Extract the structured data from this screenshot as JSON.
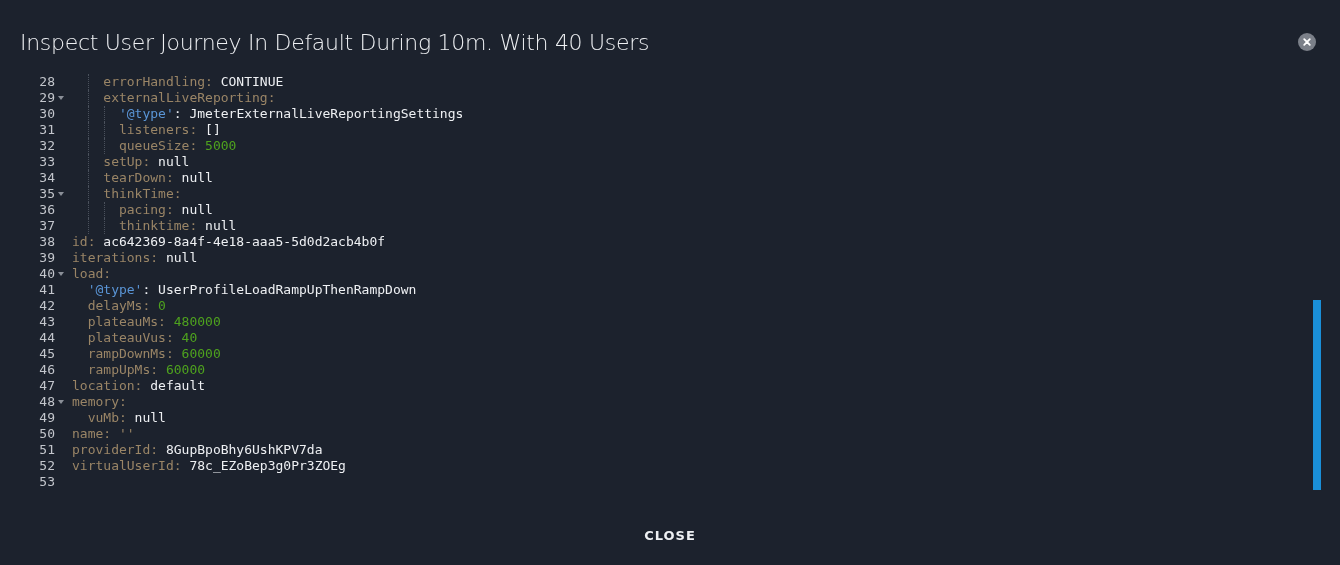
{
  "dialog": {
    "title": "Inspect User Journey In Default During 10m. With 40 Users"
  },
  "editor": {
    "lines": [
      {
        "children": [
          {
            "children": [
              {
                "number": "28",
                "foldable": false,
                "tokens": [
                  {
                    "kind": "key",
                    "text": "errorHandling:"
                  },
                  {
                    "kind": "plain",
                    "text": " CONTINUE"
                  }
                ]
              },
              {
                "number": "29",
                "foldable": true,
                "tokens": [
                  {
                    "kind": "key",
                    "text": "externalLiveReporting:"
                  }
                ],
                "children": [
                  {
                    "number": "30",
                    "foldable": false,
                    "tokens": [
                      {
                        "kind": "type",
                        "text": "'@type'"
                      },
                      {
                        "kind": "plain",
                        "text": ": JmeterExternalLiveReportingSettings"
                      }
                    ]
                  },
                  {
                    "number": "31",
                    "foldable": false,
                    "tokens": [
                      {
                        "kind": "key",
                        "text": "listeners:"
                      },
                      {
                        "kind": "plain",
                        "text": " []"
                      }
                    ]
                  },
                  {
                    "number": "32",
                    "foldable": false,
                    "tokens": [
                      {
                        "kind": "key",
                        "text": "queueSize:"
                      },
                      {
                        "kind": "number",
                        "text": " 5000"
                      }
                    ]
                  }
                ]
              },
              {
                "number": "33",
                "foldable": false,
                "tokens": [
                  {
                    "kind": "key",
                    "text": "setUp:"
                  },
                  {
                    "kind": "plain",
                    "text": " null"
                  }
                ]
              },
              {
                "number": "34",
                "foldable": false,
                "tokens": [
                  {
                    "kind": "key",
                    "text": "tearDown:"
                  },
                  {
                    "kind": "plain",
                    "text": " null"
                  }
                ]
              },
              {
                "number": "35",
                "foldable": true,
                "tokens": [
                  {
                    "kind": "key",
                    "text": "thinkTime:"
                  }
                ],
                "children": [
                  {
                    "number": "36",
                    "foldable": false,
                    "tokens": [
                      {
                        "kind": "key",
                        "text": "pacing:"
                      },
                      {
                        "kind": "plain",
                        "text": " null"
                      }
                    ]
                  },
                  {
                    "number": "37",
                    "foldable": false,
                    "tokens": [
                      {
                        "kind": "key",
                        "text": "thinktime:"
                      },
                      {
                        "kind": "plain",
                        "text": " null"
                      }
                    ]
                  }
                ]
              }
            ]
          }
        ]
      },
      {
        "number": "38",
        "foldable": false,
        "tokens": [
          {
            "kind": "key",
            "text": "id:"
          },
          {
            "kind": "plain",
            "text": " ac642369-8a4f-4e18-aaa5-5d0d2acb4b0f"
          }
        ]
      },
      {
        "number": "39",
        "foldable": false,
        "tokens": [
          {
            "kind": "key",
            "text": "iterations:"
          },
          {
            "kind": "plain",
            "text": " null"
          }
        ]
      },
      {
        "number": "40",
        "foldable": true,
        "tokens": [
          {
            "kind": "key",
            "text": "load:"
          }
        ],
        "children": [
          {
            "number": "41",
            "foldable": false,
            "tokens": [
              {
                "kind": "type",
                "text": "'@type'"
              },
              {
                "kind": "plain",
                "text": ": UserProfileLoadRampUpThenRampDown"
              }
            ]
          },
          {
            "number": "42",
            "foldable": false,
            "tokens": [
              {
                "kind": "key",
                "text": "delayMs:"
              },
              {
                "kind": "number",
                "text": " 0"
              }
            ]
          },
          {
            "number": "43",
            "foldable": false,
            "tokens": [
              {
                "kind": "key",
                "text": "plateauMs:"
              },
              {
                "kind": "number",
                "text": " 480000"
              }
            ]
          },
          {
            "number": "44",
            "foldable": false,
            "tokens": [
              {
                "kind": "key",
                "text": "plateauVus:"
              },
              {
                "kind": "number",
                "text": " 40"
              }
            ]
          },
          {
            "number": "45",
            "foldable": false,
            "tokens": [
              {
                "kind": "key",
                "text": "rampDownMs:"
              },
              {
                "kind": "number",
                "text": " 60000"
              }
            ]
          },
          {
            "number": "46",
            "foldable": false,
            "tokens": [
              {
                "kind": "key",
                "text": "rampUpMs:"
              },
              {
                "kind": "number",
                "text": " 60000"
              }
            ]
          }
        ]
      },
      {
        "number": "47",
        "foldable": false,
        "tokens": [
          {
            "kind": "key",
            "text": "location:"
          },
          {
            "kind": "plain",
            "text": " default"
          }
        ]
      },
      {
        "number": "48",
        "foldable": true,
        "tokens": [
          {
            "kind": "key",
            "text": "memory:"
          }
        ],
        "children": [
          {
            "number": "49",
            "foldable": false,
            "tokens": [
              {
                "kind": "key",
                "text": "vuMb:"
              },
              {
                "kind": "plain",
                "text": " null"
              }
            ]
          }
        ]
      },
      {
        "number": "50",
        "foldable": false,
        "tokens": [
          {
            "kind": "key",
            "text": "name: ''"
          }
        ]
      },
      {
        "number": "51",
        "foldable": false,
        "tokens": [
          {
            "kind": "key",
            "text": "providerId:"
          },
          {
            "kind": "plain",
            "text": " 8GupBpoBhy6UshKPV7da"
          }
        ]
      },
      {
        "number": "52",
        "foldable": false,
        "tokens": [
          {
            "kind": "key",
            "text": "virtualUserId:"
          },
          {
            "kind": "plain",
            "text": " 78c_EZoBep3g0Pr3ZOEg"
          }
        ]
      },
      {
        "number": "53",
        "foldable": false
      }
    ]
  },
  "buttons": [
    {
      "label": "CLOSE"
    }
  ]
}
